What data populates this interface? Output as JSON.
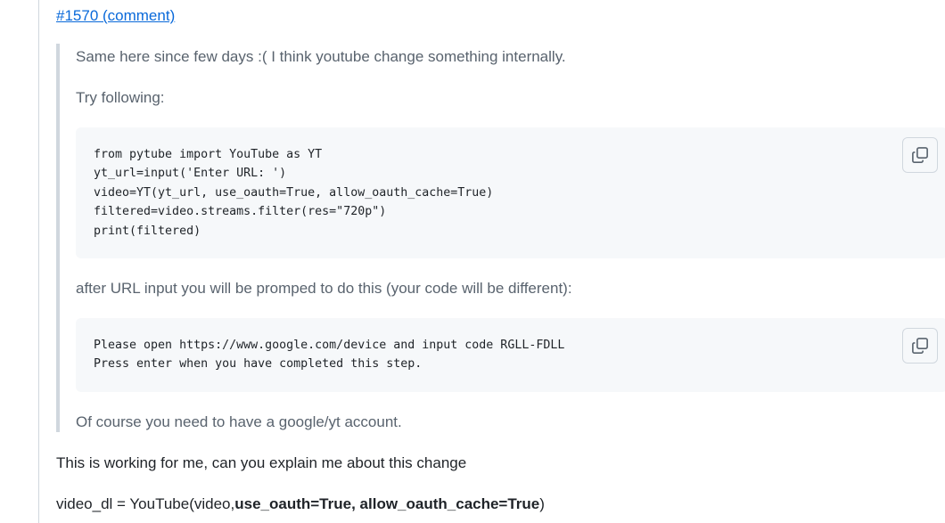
{
  "comment": {
    "issue_link": "#1570 (comment)",
    "quote": {
      "line1": "Same here since few days :( I think youtube change something internally.",
      "line2": "Try following:",
      "code1": "from pytube import YouTube as YT\nyt_url=input('Enter URL: ')\nvideo=YT(yt_url, use_oauth=True, allow_oauth_cache=True)\nfiltered=video.streams.filter(res=\"720p\")\nprint(filtered)",
      "line3": "after URL input you will be promped to do this (your code will be different):",
      "code2": "Please open https://www.google.com/device and input code RGLL-FDLL\nPress enter when you have completed this step.",
      "line4": "Of course you need to have a google/yt account."
    },
    "reply_text": "This is working for me, can you explain me about this change",
    "code_line": {
      "prefix": "video_dl = YouTube(video,",
      "bold1": "use_oauth=True",
      "sep": ", ",
      "bold2": "allow_oauth_cache=True",
      "suffix": ")"
    }
  },
  "icons": {
    "copy": "copy-icon"
  }
}
